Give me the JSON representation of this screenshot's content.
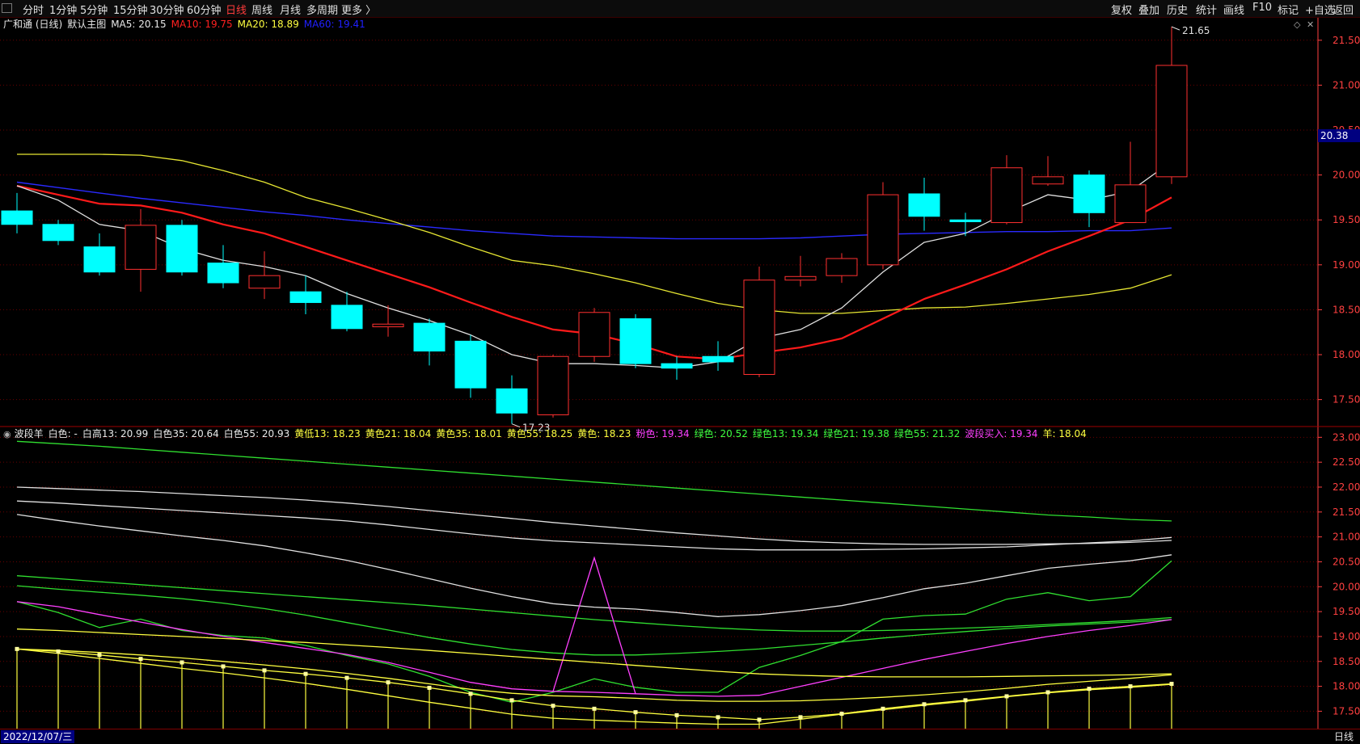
{
  "toolbar": {
    "left_items": [
      "分时",
      "1分钟",
      "5分钟",
      "15分钟",
      "30分钟",
      "60分钟",
      "日线",
      "周线",
      "月线",
      "多周期",
      "更多 〉"
    ],
    "active_index": 6,
    "right_items": [
      "复权",
      "叠加",
      "历史",
      "统计",
      "画线",
      "F10",
      "标记",
      "+自选",
      "返回"
    ]
  },
  "main_legend": {
    "stock": "广和通 (日线)",
    "template": "默认主图",
    "items": [
      {
        "text": "MA5: 20.15",
        "color": "#e8e8e8"
      },
      {
        "text": "MA10: 19.75",
        "color": "#ff2020"
      },
      {
        "text": "MA20: 18.89",
        "color": "#ffff40"
      },
      {
        "text": "MA60: 19.41",
        "color": "#2020ff"
      }
    ]
  },
  "sub_legend": {
    "name": "波段羊",
    "items": [
      {
        "text": "白色: -",
        "color": "#e8e8e8"
      },
      {
        "text": "白高13: 20.99",
        "color": "#e8e8e8"
      },
      {
        "text": "白色35: 20.64",
        "color": "#e8e8e8"
      },
      {
        "text": "白色55: 20.93",
        "color": "#e8e8e8"
      },
      {
        "text": "黄低13: 18.23",
        "color": "#ffff40"
      },
      {
        "text": "黄色21: 18.04",
        "color": "#ffff40"
      },
      {
        "text": "黄色35: 18.01",
        "color": "#ffff40"
      },
      {
        "text": "黄色55: 18.25",
        "color": "#ffff40"
      },
      {
        "text": "黄色: 18.23",
        "color": "#ffff40"
      },
      {
        "text": "粉色: 19.34",
        "color": "#ff40ff"
      },
      {
        "text": "绿色: 20.52",
        "color": "#40ff40"
      },
      {
        "text": "绿色13: 19.34",
        "color": "#40ff40"
      },
      {
        "text": "绿色21: 19.38",
        "color": "#40ff40"
      },
      {
        "text": "绿色55: 21.32",
        "color": "#40ff40"
      },
      {
        "text": "波段买入: 19.34",
        "color": "#ff40ff"
      },
      {
        "text": "羊: 18.04",
        "color": "#ffff40"
      }
    ]
  },
  "bottom": {
    "date": "2022/12/07/三",
    "period": "日线"
  },
  "price_tag": "20.38",
  "colors": {
    "up": "#ff3030",
    "down": "#00ffff",
    "ma5": "#e0e0e0",
    "ma10": "#ff1a1a",
    "ma20": "#e6e632",
    "ma60": "#2a2aff",
    "grid": "#6a0000",
    "axis": "#ff4040",
    "white": "#e0e0e0",
    "yellow": "#ffff40",
    "green": "#30e030",
    "pink": "#ff40ff"
  },
  "chart_data": [
    {
      "type": "candlestick",
      "ylim": [
        17.2,
        21.75
      ],
      "yticks": [
        17.5,
        18.0,
        18.5,
        19.0,
        19.5,
        20.0,
        20.5,
        21.0,
        21.5
      ],
      "max_label": "21.65",
      "min_label": "17.23",
      "candles": [
        {
          "o": 19.6,
          "c": 19.45,
          "h": 19.8,
          "l": 19.35
        },
        {
          "o": 19.45,
          "c": 19.27,
          "h": 19.5,
          "l": 19.22
        },
        {
          "o": 19.2,
          "c": 18.92,
          "h": 19.35,
          "l": 18.88
        },
        {
          "o": 18.95,
          "c": 19.44,
          "h": 19.62,
          "l": 18.7
        },
        {
          "o": 19.44,
          "c": 18.92,
          "h": 19.5,
          "l": 18.88
        },
        {
          "o": 19.02,
          "c": 18.8,
          "h": 19.22,
          "l": 18.74
        },
        {
          "o": 18.74,
          "c": 18.88,
          "h": 19.15,
          "l": 18.62
        },
        {
          "o": 18.7,
          "c": 18.58,
          "h": 18.88,
          "l": 18.45
        },
        {
          "o": 18.55,
          "c": 18.29,
          "h": 18.7,
          "l": 18.26
        },
        {
          "o": 18.31,
          "c": 18.34,
          "h": 18.55,
          "l": 18.2
        },
        {
          "o": 18.35,
          "c": 18.04,
          "h": 18.4,
          "l": 17.88
        },
        {
          "o": 18.15,
          "c": 17.63,
          "h": 18.22,
          "l": 17.52
        },
        {
          "o": 17.62,
          "c": 17.35,
          "h": 17.77,
          "l": 17.23
        },
        {
          "o": 17.33,
          "c": 17.98,
          "h": 18.0,
          "l": 17.3
        },
        {
          "o": 17.98,
          "c": 18.47,
          "h": 18.52,
          "l": 17.92
        },
        {
          "o": 18.4,
          "c": 17.9,
          "h": 18.45,
          "l": 17.85
        },
        {
          "o": 17.9,
          "c": 17.85,
          "h": 17.98,
          "l": 17.72
        },
        {
          "o": 17.98,
          "c": 17.92,
          "h": 18.15,
          "l": 17.82
        },
        {
          "o": 17.78,
          "c": 18.83,
          "h": 18.98,
          "l": 17.75
        },
        {
          "o": 18.83,
          "c": 18.87,
          "h": 19.1,
          "l": 18.76
        },
        {
          "o": 18.88,
          "c": 19.07,
          "h": 19.13,
          "l": 18.8
        },
        {
          "o": 19.0,
          "c": 19.78,
          "h": 19.92,
          "l": 18.95
        },
        {
          "o": 19.79,
          "c": 19.54,
          "h": 19.97,
          "l": 19.38
        },
        {
          "o": 19.5,
          "c": 19.48,
          "h": 19.58,
          "l": 19.32
        },
        {
          "o": 19.47,
          "c": 20.08,
          "h": 20.22,
          "l": 19.45
        },
        {
          "o": 19.9,
          "c": 19.98,
          "h": 20.21,
          "l": 19.88
        },
        {
          "o": 20.0,
          "c": 19.58,
          "h": 20.05,
          "l": 19.42
        },
        {
          "o": 19.47,
          "c": 19.89,
          "h": 20.37,
          "l": 19.47
        },
        {
          "o": 19.98,
          "c": 21.22,
          "h": 21.65,
          "l": 19.9
        }
      ],
      "ma5": [
        19.88,
        19.72,
        19.45,
        19.38,
        19.18,
        19.05,
        18.98,
        18.88,
        18.68,
        18.52,
        18.38,
        18.22,
        18.0,
        17.9,
        17.9,
        17.88,
        17.85,
        17.92,
        18.18,
        18.28,
        18.52,
        18.92,
        19.25,
        19.35,
        19.58,
        19.78,
        19.72,
        19.82,
        20.15
      ],
      "ma10": [
        19.88,
        19.78,
        19.68,
        19.66,
        19.58,
        19.45,
        19.35,
        19.2,
        19.05,
        18.9,
        18.75,
        18.58,
        18.42,
        18.28,
        18.23,
        18.12,
        17.98,
        17.95,
        18.02,
        18.08,
        18.18,
        18.4,
        18.62,
        18.78,
        18.95,
        19.15,
        19.32,
        19.5,
        19.75
      ],
      "ma20": [
        20.23,
        20.23,
        20.23,
        20.22,
        20.16,
        20.05,
        19.92,
        19.75,
        19.63,
        19.5,
        19.36,
        19.2,
        19.05,
        18.99,
        18.9,
        18.8,
        18.68,
        18.57,
        18.5,
        18.46,
        18.46,
        18.49,
        18.52,
        18.53,
        18.57,
        18.62,
        18.67,
        18.74,
        18.89
      ],
      "ma60": [
        19.92,
        19.86,
        19.8,
        19.74,
        19.69,
        19.64,
        19.59,
        19.55,
        19.5,
        19.46,
        19.42,
        19.38,
        19.35,
        19.32,
        19.31,
        19.3,
        19.29,
        19.29,
        19.29,
        19.3,
        19.32,
        19.34,
        19.35,
        19.36,
        19.37,
        19.37,
        19.38,
        19.38,
        19.41
      ]
    },
    {
      "type": "line",
      "ylim": [
        17.15,
        23.2
      ],
      "yticks": [
        17.5,
        18.0,
        18.5,
        19.0,
        19.5,
        20.0,
        20.5,
        21.0,
        21.5,
        22.0,
        22.5,
        23.0
      ],
      "series": [
        {
          "name": "绿色55",
          "color": "green",
          "values": [
            22.92,
            22.87,
            22.82,
            22.76,
            22.7,
            22.64,
            22.58,
            22.52,
            22.46,
            22.4,
            22.34,
            22.28,
            22.22,
            22.16,
            22.1,
            22.04,
            21.98,
            21.92,
            21.86,
            21.8,
            21.74,
            21.68,
            21.62,
            21.56,
            21.5,
            21.44,
            21.4,
            21.35,
            21.32
          ]
        },
        {
          "name": "白色55",
          "color": "white",
          "values": [
            22.0,
            21.97,
            21.94,
            21.91,
            21.87,
            21.83,
            21.79,
            21.74,
            21.68,
            21.61,
            21.53,
            21.45,
            21.37,
            21.29,
            21.22,
            21.15,
            21.08,
            21.02,
            20.96,
            20.91,
            20.88,
            20.86,
            20.85,
            20.85,
            20.85,
            20.86,
            20.87,
            20.89,
            20.93
          ]
        },
        {
          "name": "白高13",
          "color": "white",
          "values": [
            21.72,
            21.68,
            21.63,
            21.58,
            21.53,
            21.48,
            21.43,
            21.38,
            21.32,
            21.24,
            21.15,
            21.06,
            20.98,
            20.92,
            20.88,
            20.84,
            20.8,
            20.76,
            20.74,
            20.74,
            20.74,
            20.75,
            20.76,
            20.78,
            20.8,
            20.84,
            20.88,
            20.92,
            20.99
          ]
        },
        {
          "name": "白色35",
          "color": "white",
          "values": [
            21.45,
            21.33,
            21.22,
            21.12,
            21.02,
            20.93,
            20.82,
            20.68,
            20.53,
            20.35,
            20.16,
            19.97,
            19.8,
            19.66,
            19.59,
            19.55,
            19.48,
            19.4,
            19.44,
            19.52,
            19.62,
            19.78,
            19.96,
            20.07,
            20.22,
            20.37,
            20.45,
            20.52,
            20.64
          ]
        },
        {
          "name": "绿色21",
          "color": "green",
          "values": [
            20.22,
            20.16,
            20.1,
            20.04,
            19.98,
            19.92,
            19.86,
            19.8,
            19.74,
            19.68,
            19.62,
            19.55,
            19.48,
            19.41,
            19.34,
            19.28,
            19.22,
            19.17,
            19.13,
            19.11,
            19.11,
            19.12,
            19.14,
            19.17,
            19.2,
            19.24,
            19.28,
            19.32,
            19.38
          ]
        },
        {
          "name": "绿色13",
          "color": "green",
          "values": [
            20.02,
            19.95,
            19.89,
            19.83,
            19.76,
            19.67,
            19.56,
            19.43,
            19.28,
            19.13,
            18.98,
            18.85,
            18.74,
            18.67,
            18.63,
            18.63,
            18.66,
            18.7,
            18.75,
            18.82,
            18.89,
            18.97,
            19.04,
            19.1,
            19.16,
            19.21,
            19.25,
            19.29,
            19.34
          ]
        },
        {
          "name": "绿色",
          "color": "green",
          "values": [
            19.7,
            19.48,
            19.18,
            19.35,
            19.12,
            19.02,
            18.97,
            18.82,
            18.62,
            18.45,
            18.2,
            17.88,
            17.68,
            17.88,
            18.15,
            17.98,
            17.88,
            17.88,
            18.38,
            18.62,
            18.9,
            19.35,
            19.42,
            19.45,
            19.75,
            19.88,
            19.72,
            19.8,
            20.52
          ]
        },
        {
          "name": "粉色",
          "color": "pink",
          "values": [
            19.7,
            19.6,
            19.44,
            19.29,
            19.14,
            19.0,
            18.88,
            18.76,
            18.64,
            18.48,
            18.28,
            18.08,
            17.95,
            17.9,
            17.88,
            17.85,
            17.82,
            17.8,
            17.82,
            18.0,
            18.18,
            18.36,
            18.54,
            18.7,
            18.86,
            19.0,
            19.12,
            19.22,
            19.34
          ]
        },
        {
          "name": "波段买入",
          "color": "pink",
          "values": [
            null,
            null,
            null,
            null,
            null,
            null,
            null,
            null,
            null,
            null,
            null,
            null,
            null,
            17.9,
            20.58,
            17.85,
            null,
            null,
            null,
            null,
            null,
            null,
            null,
            null,
            null,
            null,
            null,
            null,
            null
          ]
        },
        {
          "name": "黄色55",
          "color": "yellow",
          "values": [
            19.15,
            19.12,
            19.08,
            19.04,
            19.0,
            18.96,
            18.92,
            18.88,
            18.83,
            18.78,
            18.72,
            18.66,
            18.6,
            18.54,
            18.48,
            18.42,
            18.36,
            18.3,
            18.25,
            18.22,
            18.2,
            18.19,
            18.19,
            18.19,
            18.2,
            18.21,
            18.22,
            18.23,
            18.25
          ]
        },
        {
          "name": "黄低13",
          "color": "yellow",
          "values": [
            18.75,
            18.72,
            18.68,
            18.63,
            18.57,
            18.5,
            18.43,
            18.35,
            18.26,
            18.16,
            18.05,
            17.94,
            17.86,
            17.81,
            17.79,
            17.76,
            17.72,
            17.7,
            17.7,
            17.71,
            17.74,
            17.78,
            17.83,
            17.89,
            17.96,
            18.04,
            18.1,
            18.16,
            18.23
          ]
        },
        {
          "name": "黄色21",
          "color": "yellow",
          "values": [
            18.75,
            18.66,
            18.56,
            18.46,
            18.36,
            18.27,
            18.17,
            18.06,
            17.94,
            17.81,
            17.68,
            17.56,
            17.44,
            17.36,
            17.32,
            17.29,
            17.26,
            17.24,
            17.24,
            17.34,
            17.44,
            17.53,
            17.62,
            17.7,
            17.79,
            17.87,
            17.93,
            17.98,
            18.04
          ]
        },
        {
          "name": "黄色",
          "color": "yellow",
          "values": [
            18.75,
            18.7,
            18.63,
            18.55,
            18.48,
            18.4,
            18.32,
            18.25,
            18.17,
            18.08,
            17.97,
            17.85,
            17.72,
            17.61,
            17.55,
            17.48,
            17.42,
            17.38,
            17.33,
            17.38,
            17.45,
            17.55,
            17.64,
            17.72,
            17.8,
            17.88,
            17.95,
            18.0,
            18.05
          ]
        }
      ],
      "bar_base": 17.15
    }
  ]
}
